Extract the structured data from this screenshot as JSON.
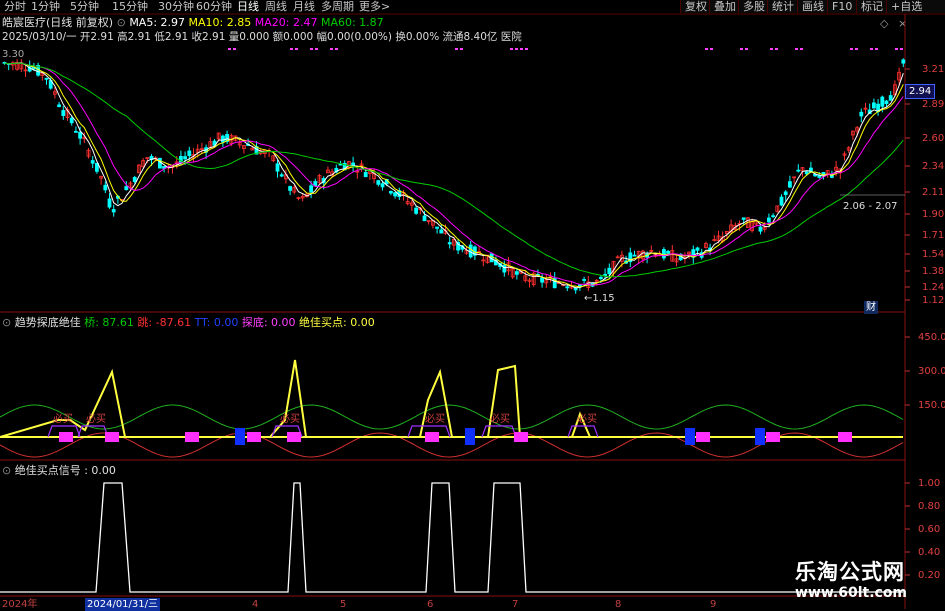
{
  "toolbar": {
    "periods": [
      "分时",
      "1分钟",
      "5分钟",
      "15分钟",
      "30分钟",
      "60分钟",
      "日线",
      "周线",
      "月线",
      "多周期",
      "更多"
    ],
    "right_buttons": [
      "复权",
      "叠加",
      "多股",
      "统计",
      "画线",
      "F10",
      "标记",
      "+自选"
    ]
  },
  "header": {
    "stock_title": "皓宸医疗(日线 前复权)",
    "ma5": "MA5: 2.97",
    "ma10": "MA10: 2.85",
    "ma20": "MA20: 2.47",
    "ma60": "MA60: 1.87",
    "info_line": "2025/03/10/一 开2.91 高2.91 低2.91 收2.91 量0.000 额0.000 幅0.00(0.00%) 换0.00% 流通8.40亿 医院"
  },
  "main_chart": {
    "price_ticks": [
      "3.21",
      "2.89",
      "2.60",
      "2.34",
      "2.11",
      "1.90",
      "1.71",
      "1.54",
      "1.38",
      "1.24",
      "1.12"
    ],
    "current_price": "2.94",
    "low_marker": "1.15",
    "range_label": "2.06 - 2.07",
    "cai_label": "财",
    "top_left_value": "3.30"
  },
  "indicator1": {
    "name": "趋势探底绝佳",
    "qiao": "桥: 87.61",
    "tiao": "跳: -87.61",
    "tt": "TT: 0.00",
    "tandi": "探底: 0.00",
    "best_buy": "绝佳买点: 0.00",
    "ticks": [
      "450.0",
      "300.0",
      "150.0"
    ],
    "buy_label": "必买"
  },
  "indicator2": {
    "name": "绝佳买点信号",
    "value": ": 0.00",
    "ticks": [
      "1.00",
      "0.80",
      "0.60",
      "0.40",
      "0.20"
    ]
  },
  "timeline": {
    "year": "2024年",
    "cursor_date": "2024/01/31/三",
    "months": [
      "4",
      "5",
      "6",
      "7",
      "8",
      "9"
    ]
  },
  "watermark": {
    "line1": "乐淘公式网",
    "line2": "www.60lt.com"
  },
  "colors": {
    "ma5": "#ffffff",
    "ma10": "#ffff00",
    "ma20": "#ff00ff",
    "ma60": "#00cc00",
    "up": "#ff3030",
    "down": "#00ffff",
    "yellow": "#ffff40"
  }
}
